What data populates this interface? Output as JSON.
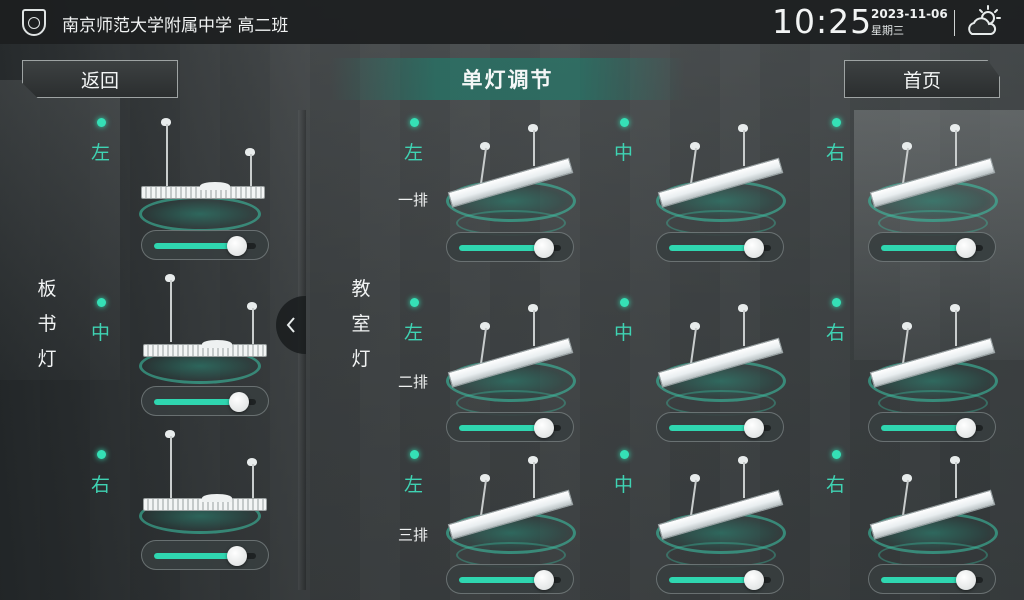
{
  "header": {
    "school": "南京师范大学附属中学 高二班",
    "time": "10:25",
    "date": "2023-11-06",
    "weekday": "星期三",
    "weather_icon": "partly-cloudy-icon"
  },
  "nav": {
    "back_label": "返回",
    "title": "单灯调节",
    "home_label": "首页"
  },
  "board_lights": {
    "group_label": [
      "板",
      "书",
      "灯"
    ],
    "units": [
      {
        "position": "左",
        "on": true,
        "level": 0.8
      },
      {
        "position": "中",
        "on": true,
        "level": 0.82
      },
      {
        "position": "右",
        "on": true,
        "level": 0.8
      }
    ]
  },
  "classroom_lights": {
    "group_label": [
      "教",
      "室",
      "灯"
    ],
    "rows": [
      {
        "label": "一排",
        "units": [
          {
            "position": "左",
            "on": true,
            "level": 0.82
          },
          {
            "position": "中",
            "on": true,
            "level": 0.82
          },
          {
            "position": "右",
            "on": true,
            "level": 0.82
          }
        ]
      },
      {
        "label": "二排",
        "units": [
          {
            "position": "左",
            "on": true,
            "level": 0.82
          },
          {
            "position": "中",
            "on": true,
            "level": 0.82
          },
          {
            "position": "右",
            "on": true,
            "level": 0.82
          }
        ]
      },
      {
        "label": "三排",
        "units": [
          {
            "position": "左",
            "on": true,
            "level": 0.82
          },
          {
            "position": "中",
            "on": true,
            "level": 0.82
          },
          {
            "position": "右",
            "on": true,
            "level": 0.82
          }
        ]
      }
    ]
  },
  "colors": {
    "accent": "#2fd6b0",
    "status_on": "#35e0b6",
    "position_text": "#3fd3b3"
  }
}
